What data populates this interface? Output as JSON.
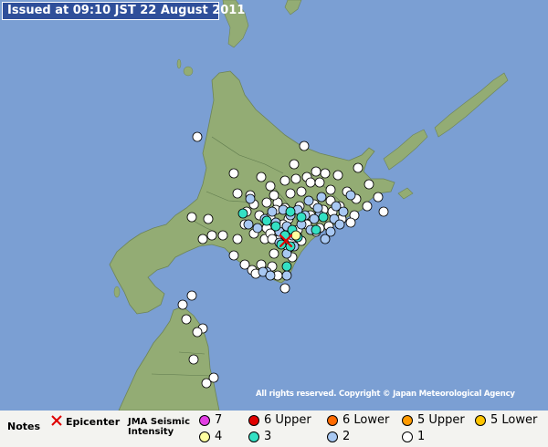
{
  "header": {
    "issued": "Issued at 09:10 JST  22 August 2011"
  },
  "copyright": "All rights reserved. Copyright © Japan Meteorological Agency",
  "legend": {
    "notes": "Notes",
    "epicenter": "Epicenter",
    "jma_title": "JMA Seismic Intensity",
    "items": [
      {
        "label": "7",
        "color": "#e23ee3"
      },
      {
        "label": "6 Upper",
        "color": "#e00000"
      },
      {
        "label": "6 Lower",
        "color": "#ff6a00"
      },
      {
        "label": "5 Upper",
        "color": "#ff9a00"
      },
      {
        "label": "5 Lower",
        "color": "#ffc400"
      },
      {
        "label": "4",
        "color": "#ffffa0"
      },
      {
        "label": "3",
        "color": "#33e0c4"
      },
      {
        "label": "2",
        "color": "#a8c8f2"
      },
      {
        "label": "1",
        "color": "#ffffff"
      }
    ]
  },
  "colors": {
    "sea": "#7b9fd3",
    "land": "#93ac74",
    "epicenter": "#e00000"
  },
  "stations": {
    "intensity_1": 86,
    "intensity_2": 34,
    "intensity_3": 13,
    "intensity_4": 1
  }
}
